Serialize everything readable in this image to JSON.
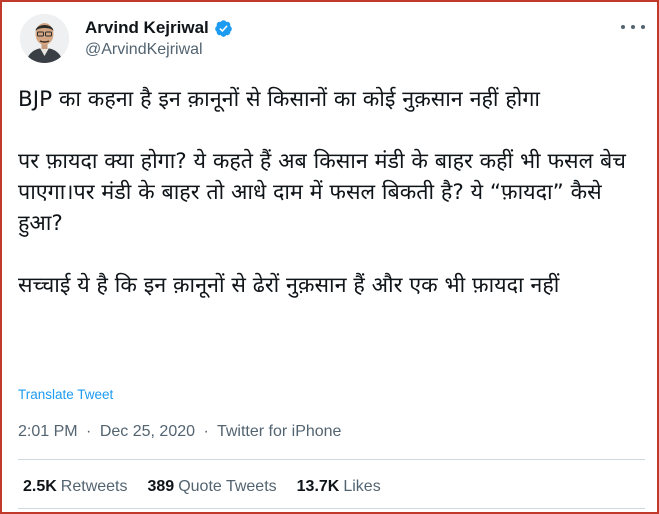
{
  "author": {
    "display_name": "Arvind Kejriwal",
    "handle": "@ArvindKejriwal",
    "verified_icon": "verified-badge-icon",
    "avatar_icon": "profile-avatar"
  },
  "more_icon": "more-options-icon",
  "tweet": {
    "paragraphs": [
      "BJP का कहना है इन क़ानूनों से किसानों का कोई नुक़सान नहीं होगा",
      "पर फ़ायदा क्या होगा? ये कहते हैं अब किसान मंडी के बाहर कहीं भी फसल बेच पाएगा।पर मंडी के बाहर तो आधे दाम में फसल बिकती है? ये “फ़ायदा” कैसे हुआ?",
      "सच्चाई ये है कि इन क़ानूनों से ढेरों नुक़सान हैं और एक भी फ़ायदा नहीं"
    ],
    "translate_label": "Translate Tweet"
  },
  "meta": {
    "time": "2:01 PM",
    "separator": "·",
    "date": "Dec 25, 2020",
    "source": "Twitter for iPhone"
  },
  "stats": {
    "retweets_count": "2.5K",
    "retweets_label": "Retweets",
    "quotes_count": "389",
    "quotes_label": "Quote Tweets",
    "likes_count": "13.7K",
    "likes_label": "Likes"
  },
  "colors": {
    "frame_border": "#c0392b",
    "link_blue": "#1d9bf0",
    "secondary_text": "#536471",
    "primary_text": "#0f1419"
  }
}
